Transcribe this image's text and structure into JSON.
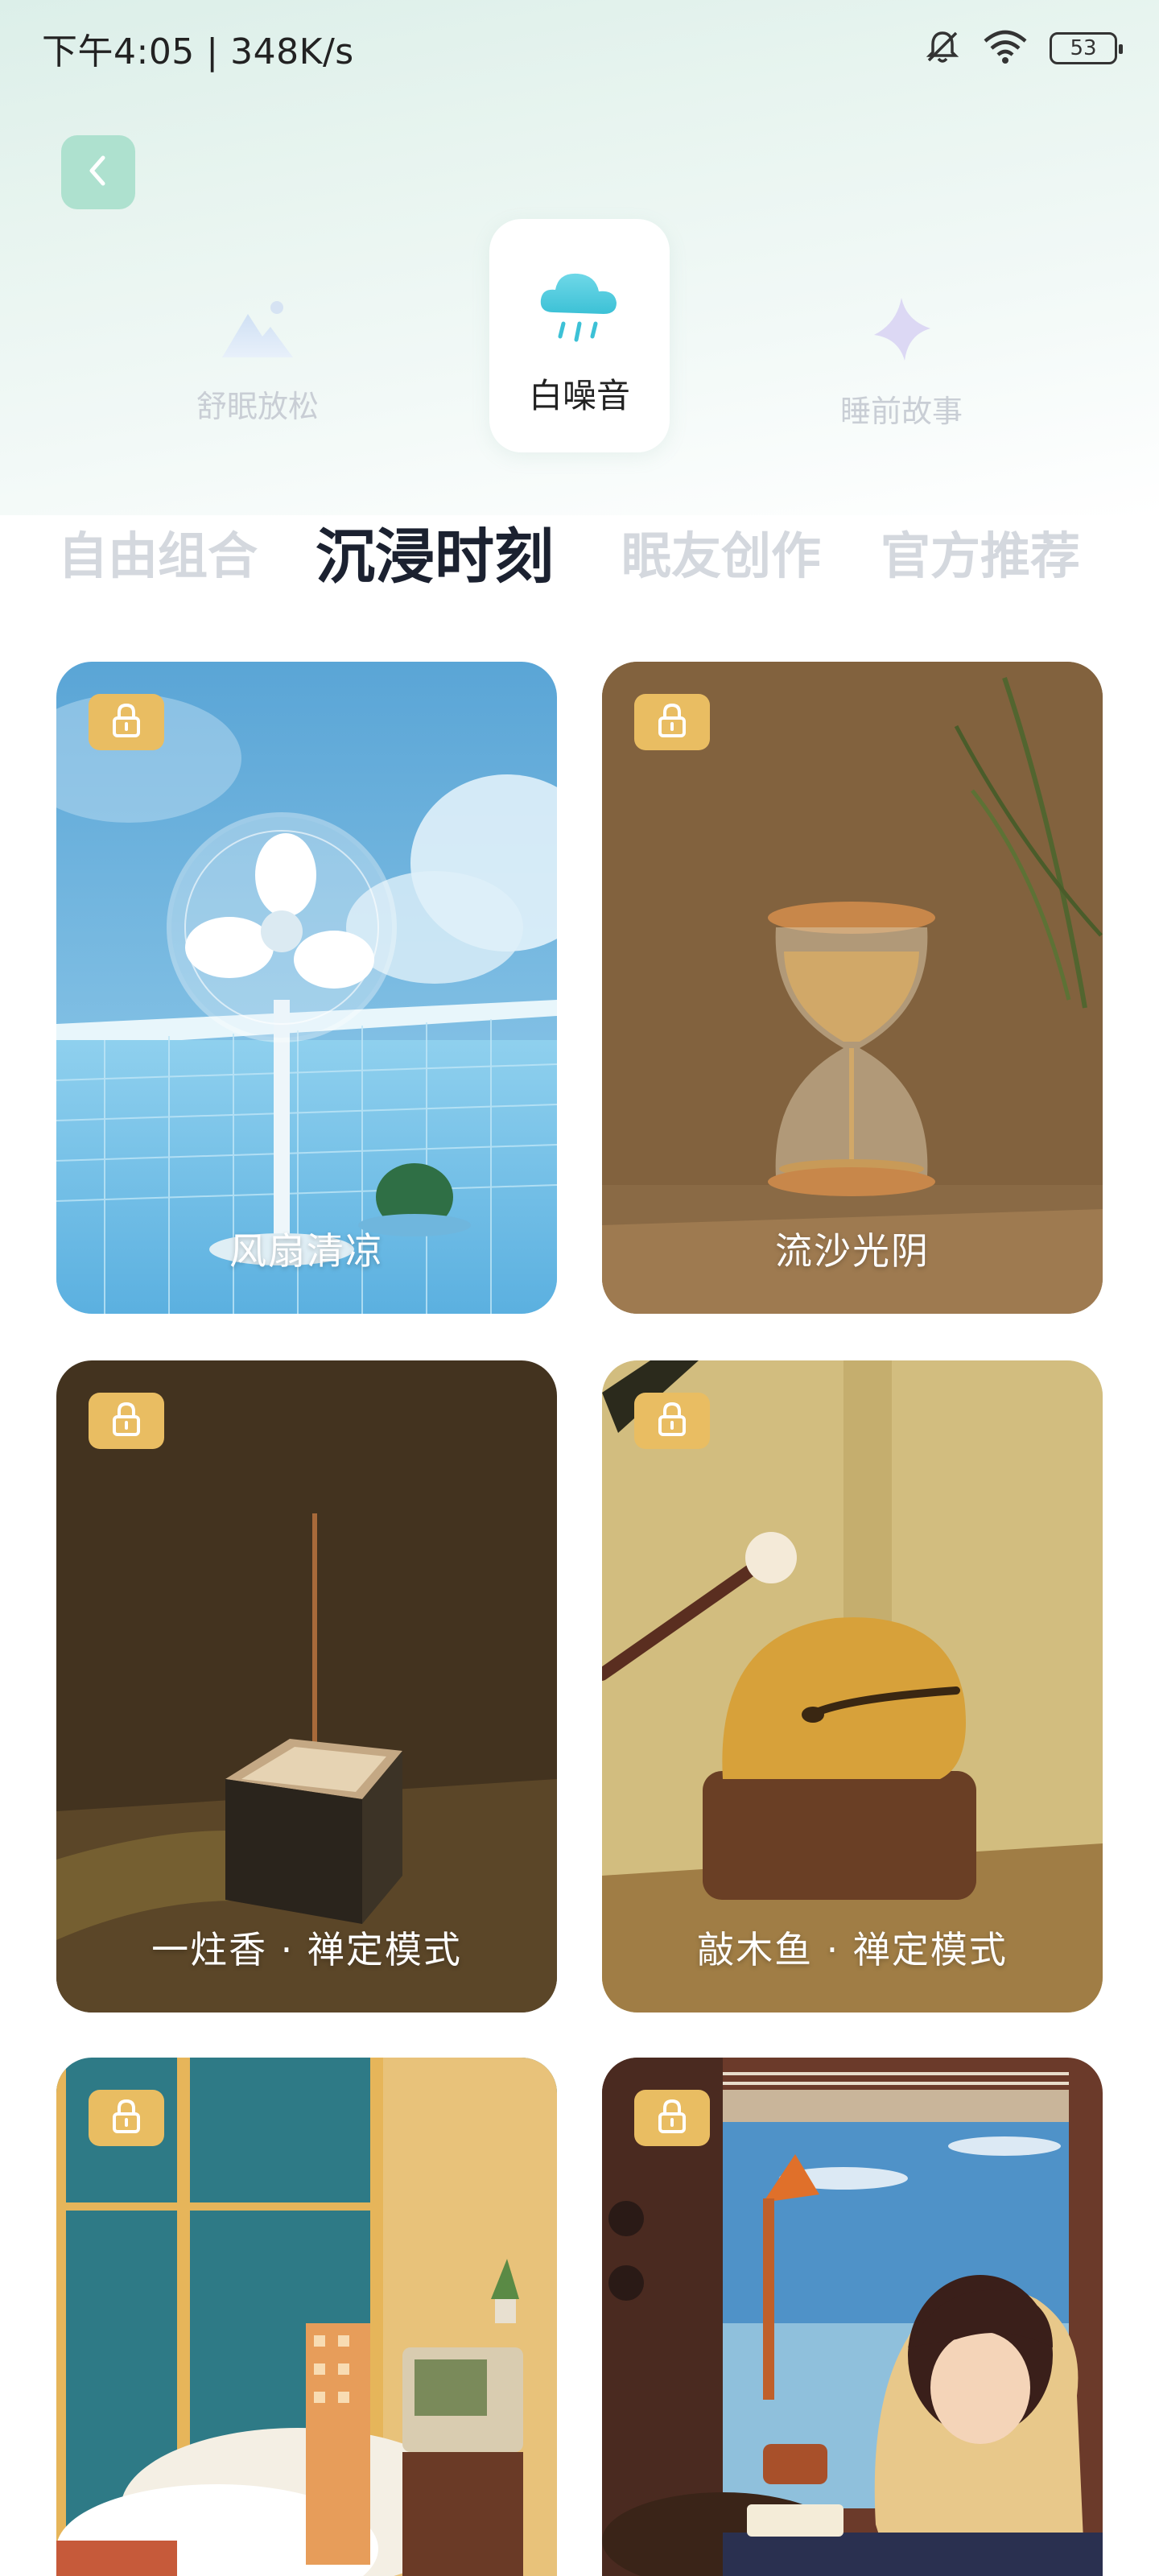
{
  "status_bar": {
    "time_speed": "下午4:05 | 348K/s",
    "battery": "53"
  },
  "categories": [
    {
      "label": "舒眠放松",
      "icon": "mountain-icon"
    },
    {
      "label": "白噪音",
      "icon": "rain-cloud-icon"
    },
    {
      "label": "睡前故事",
      "icon": "star-icon"
    }
  ],
  "sub_tabs": [
    "自由组合",
    "沉浸时刻",
    "眠友创作",
    "官方推荐"
  ],
  "cards": [
    {
      "title": "风扇清凉",
      "locked": true
    },
    {
      "title": "流沙光阴",
      "locked": true
    },
    {
      "title": "一炷香 · 禅定模式",
      "locked": true
    },
    {
      "title": "敲木鱼 · 禅定模式",
      "locked": true
    },
    {
      "title": "",
      "locked": true
    },
    {
      "title": "",
      "locked": true
    }
  ],
  "colors": {
    "lock_badge": "#e9bd62",
    "back_button": "#aee1cf",
    "active_tab_text": "#1b2130",
    "inactive_tab_text": "#d4d8de"
  }
}
